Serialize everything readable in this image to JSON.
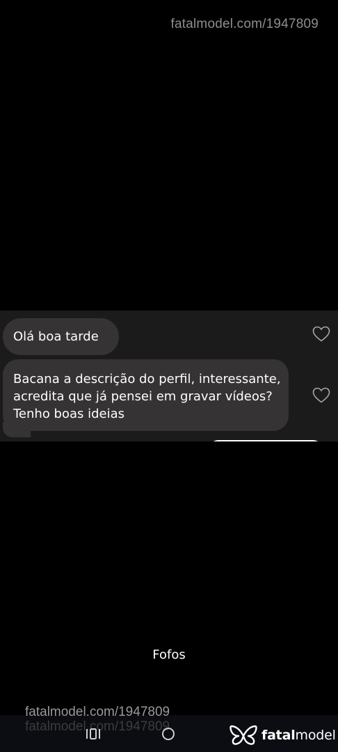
{
  "watermark": {
    "top_text": "fatalmodel.com/1947809",
    "bottom_text": "fatalmodel.com/1947809",
    "bottom_shadow_text": "fatalmodel.com/1947809"
  },
  "chat": {
    "messages": [
      {
        "text": "Olá boa tarde",
        "liked": false
      },
      {
        "text": "Bacana a descrição do perfil, interessante, acredita que já pensei em gravar vídeos? Tenho boas ideias",
        "liked": false
      }
    ],
    "icons": {
      "like": "heart-outline-icon"
    }
  },
  "sheet": {
    "label": "Fofos"
  },
  "nav": {
    "icons": [
      "recents-icon",
      "home-icon"
    ]
  },
  "brand": {
    "name_bold": "fatal",
    "name_regular": "model",
    "logo": "butterfly-logo"
  },
  "colors": {
    "background": "#000000",
    "chat_strip": "#1c1b1b",
    "bubble": "#353333",
    "watermark": "#8e8e8e"
  }
}
